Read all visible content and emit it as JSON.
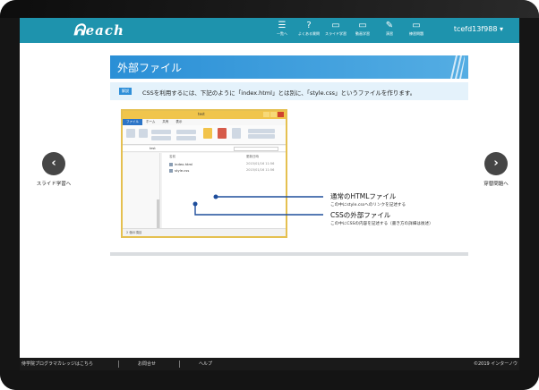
{
  "header": {
    "logo_text": "each",
    "nav": [
      {
        "icon": "list-icon",
        "glyph": "☰",
        "label": "一覧へ"
      },
      {
        "icon": "help-icon",
        "glyph": "?",
        "label": "よくある質問"
      },
      {
        "icon": "slides-icon",
        "glyph": "▭",
        "label": "スライド学習"
      },
      {
        "icon": "video-icon",
        "glyph": "▭",
        "label": "動画学習"
      },
      {
        "icon": "pencil-icon",
        "glyph": "✎",
        "label": "演習"
      },
      {
        "icon": "exercise-icon",
        "glyph": "▭",
        "label": "練習問題"
      }
    ],
    "user": "tcefd13f988 ▾"
  },
  "slide": {
    "title": "外部ファイル",
    "badge": "解説",
    "description": "CSSを利用するには、下記のように「index.html」とは別に、「style.css」というファイルを作ります。",
    "explorer": {
      "title": "test",
      "tabs": [
        "ファイル",
        "ホーム",
        "共有",
        "表示"
      ],
      "address": "test",
      "columns": [
        "名前",
        "更新日時"
      ],
      "files": [
        {
          "name": "index.html",
          "date": "2015/01/16 11:56"
        },
        {
          "name": "style.css",
          "date": "2015/01/16 11:56"
        }
      ],
      "status": "2 個の項目"
    },
    "annotations": [
      {
        "title": "通常のHTMLファイル",
        "sub": "この中にstyle.cssへのリンクを記述する"
      },
      {
        "title": "CSSの外部ファイル",
        "sub": "この中にCSSの内容を記述する（書き方の詳細は後述）"
      }
    ],
    "title_color": "#2a8fd6"
  },
  "side_nav": {
    "prev_label": "スライド学習へ",
    "next_label": "穿替問題へ"
  },
  "footer": {
    "items": [
      "侍学院プログラマカレッジはこちら",
      "お問合せ",
      "ヘルプ"
    ],
    "copyright": "©2019 インターノウ"
  },
  "colors": {
    "header": "#1e93ad",
    "accent": "#2f8fd8",
    "footer": "#1a1a1a"
  }
}
